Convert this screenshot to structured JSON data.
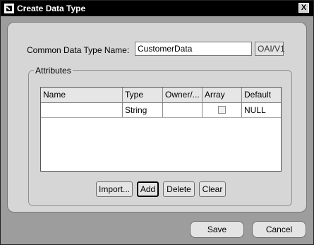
{
  "window": {
    "title": "Create Data Type",
    "close_label": "X"
  },
  "form": {
    "name_label": "Common Data Type Name:",
    "name_value": "CustomerData",
    "version_value": "OAI/V1"
  },
  "attributes": {
    "legend": "Attributes",
    "columns": [
      "Name",
      "Type",
      "Owner/...",
      "Array",
      "Default"
    ],
    "rows": [
      {
        "name": "",
        "type": "String",
        "owner": "",
        "array": false,
        "default": "NULL"
      }
    ],
    "buttons": {
      "import": "Import...",
      "add": "Add",
      "delete": "Delete",
      "clear": "Clear"
    }
  },
  "footer": {
    "save": "Save",
    "cancel": "Cancel"
  }
}
